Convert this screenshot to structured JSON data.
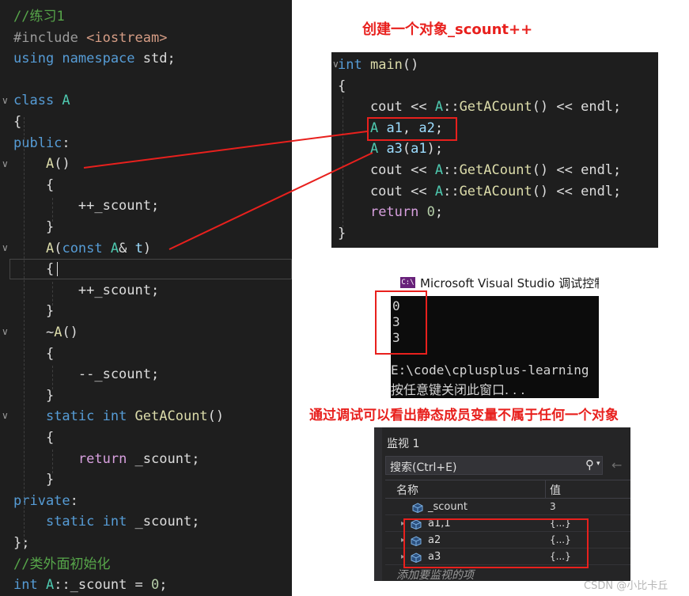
{
  "code_panel": {
    "lines": [
      [
        {
          "c": "cm",
          "t": "//练习1"
        }
      ],
      [
        {
          "c": "pp",
          "t": "#include "
        },
        {
          "c": "st",
          "t": "<iostream>"
        }
      ],
      [
        {
          "c": "kw",
          "t": "using namespace "
        },
        {
          "c": "pl",
          "t": "std;"
        }
      ],
      [],
      [
        {
          "c": "kw",
          "t": "class "
        },
        {
          "c": "ty",
          "t": "A"
        }
      ],
      [
        {
          "c": "pl",
          "t": "{"
        }
      ],
      [
        {
          "c": "kw",
          "t": "public"
        },
        {
          "c": "pl",
          "t": ":"
        }
      ],
      [
        {
          "c": "pl",
          "t": "    "
        },
        {
          "c": "fn",
          "t": "A"
        },
        {
          "c": "pl",
          "t": "()"
        }
      ],
      [
        {
          "c": "pl",
          "t": "    {"
        }
      ],
      [
        {
          "c": "pl",
          "t": "        ++_scount;"
        }
      ],
      [
        {
          "c": "pl",
          "t": "    }"
        }
      ],
      [
        {
          "c": "pl",
          "t": "    "
        },
        {
          "c": "fn",
          "t": "A"
        },
        {
          "c": "pl",
          "t": "("
        },
        {
          "c": "kw",
          "t": "const "
        },
        {
          "c": "ty",
          "t": "A"
        },
        {
          "c": "pl",
          "t": "& "
        },
        {
          "c": "pa",
          "t": "t"
        },
        {
          "c": "pl",
          "t": ")"
        }
      ],
      [
        {
          "c": "pl",
          "t": "    {"
        }
      ],
      [
        {
          "c": "pl",
          "t": "        ++_scount;"
        }
      ],
      [
        {
          "c": "pl",
          "t": "    }"
        }
      ],
      [
        {
          "c": "pl",
          "t": "    ~"
        },
        {
          "c": "fn",
          "t": "A"
        },
        {
          "c": "pl",
          "t": "()"
        }
      ],
      [
        {
          "c": "pl",
          "t": "    {"
        }
      ],
      [
        {
          "c": "pl",
          "t": "        --_scount;"
        }
      ],
      [
        {
          "c": "pl",
          "t": "    }"
        }
      ],
      [
        {
          "c": "pl",
          "t": "    "
        },
        {
          "c": "kw",
          "t": "static int "
        },
        {
          "c": "fn",
          "t": "GetACount"
        },
        {
          "c": "pl",
          "t": "()"
        }
      ],
      [
        {
          "c": "pl",
          "t": "    {"
        }
      ],
      [
        {
          "c": "pl",
          "t": "        "
        },
        {
          "c": "ctl",
          "t": "return"
        },
        {
          "c": "pl",
          "t": " _scount;"
        }
      ],
      [
        {
          "c": "pl",
          "t": "    }"
        }
      ],
      [
        {
          "c": "kw",
          "t": "private"
        },
        {
          "c": "pl",
          "t": ":"
        }
      ],
      [
        {
          "c": "pl",
          "t": "    "
        },
        {
          "c": "kw",
          "t": "static int "
        },
        {
          "c": "pl",
          "t": "_scount;"
        }
      ],
      [
        {
          "c": "pl",
          "t": "};"
        }
      ],
      [
        {
          "c": "cm",
          "t": "//类外面初始化"
        }
      ],
      [
        {
          "c": "kw",
          "t": "int "
        },
        {
          "c": "ty",
          "t": "A"
        },
        {
          "c": "pl",
          "t": "::_scount = "
        },
        {
          "c": "nm",
          "t": "0"
        },
        {
          "c": "pl",
          "t": ";"
        }
      ]
    ]
  },
  "main_panel": {
    "lines": [
      [
        {
          "c": "kw",
          "t": "int "
        },
        {
          "c": "fn",
          "t": "main"
        },
        {
          "c": "pl",
          "t": "()"
        }
      ],
      [
        {
          "c": "pl",
          "t": "{"
        }
      ],
      [
        {
          "c": "pl",
          "t": "    cout << "
        },
        {
          "c": "ty",
          "t": "A"
        },
        {
          "c": "pl",
          "t": "::"
        },
        {
          "c": "fn",
          "t": "GetACount"
        },
        {
          "c": "pl",
          "t": "() << endl;"
        }
      ],
      [
        {
          "c": "pl",
          "t": "    "
        },
        {
          "c": "ty",
          "t": "A "
        },
        {
          "c": "pa",
          "t": "a1"
        },
        {
          "c": "pl",
          "t": ", "
        },
        {
          "c": "pa",
          "t": "a2"
        },
        {
          "c": "pl",
          "t": ";"
        }
      ],
      [
        {
          "c": "pl",
          "t": "    "
        },
        {
          "c": "ty",
          "t": "A "
        },
        {
          "c": "pa",
          "t": "a3"
        },
        {
          "c": "pl",
          "t": "("
        },
        {
          "c": "pa",
          "t": "a1"
        },
        {
          "c": "pl",
          "t": ");"
        }
      ],
      [
        {
          "c": "pl",
          "t": "    cout << "
        },
        {
          "c": "ty",
          "t": "A"
        },
        {
          "c": "pl",
          "t": "::"
        },
        {
          "c": "fn",
          "t": "GetACount"
        },
        {
          "c": "pl",
          "t": "() << endl;"
        }
      ],
      [
        {
          "c": "pl",
          "t": "    cout << "
        },
        {
          "c": "ty",
          "t": "A"
        },
        {
          "c": "pl",
          "t": "::"
        },
        {
          "c": "fn",
          "t": "GetACount"
        },
        {
          "c": "pl",
          "t": "() << endl;"
        }
      ],
      [
        {
          "c": "pl",
          "t": "    "
        },
        {
          "c": "ctl",
          "t": "return "
        },
        {
          "c": "nm",
          "t": "0"
        },
        {
          "c": "pl",
          "t": ";"
        }
      ],
      [
        {
          "c": "pl",
          "t": "}"
        }
      ]
    ]
  },
  "annotations": {
    "create_object": "创建一个对象_scount++",
    "debug_note": "通过调试可以看出静态成员变量不属于任何一个对象"
  },
  "console": {
    "title": "Microsoft Visual Studio 调试控制",
    "icon_text": "C:\\",
    "output": [
      "0",
      "3",
      "3"
    ],
    "path_line": "E:\\code\\cplusplus-learning",
    "press_key": "按任意键关闭此窗口. . ."
  },
  "watch": {
    "title": "监视 1",
    "search_placeholder": "搜索(Ctrl+E)",
    "col_name": "名称",
    "col_value": "值",
    "rows": [
      {
        "name": "_scount",
        "value": "3"
      },
      {
        "name": "a1,1",
        "value": "{...}"
      },
      {
        "name": "a2",
        "value": "{...}"
      },
      {
        "name": "a3",
        "value": "{...}"
      }
    ],
    "add_item": "添加要监视的项"
  },
  "watermark": "CSDN @小比卡丘",
  "colors": {
    "editor_bg": "#1e1e1e",
    "annotation_red": "#e8201d",
    "console_bg": "#0c0c0c"
  }
}
